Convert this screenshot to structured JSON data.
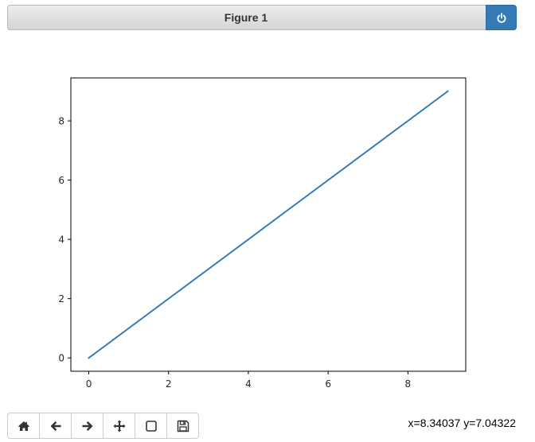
{
  "window": {
    "title": "Figure 1",
    "close_icon": "power-icon",
    "accent_color": "#337ab7"
  },
  "toolbar": {
    "buttons": [
      {
        "name": "home",
        "icon": "home-icon"
      },
      {
        "name": "back",
        "icon": "arrow-left-icon"
      },
      {
        "name": "forward",
        "icon": "arrow-right-icon"
      },
      {
        "name": "pan",
        "icon": "move-icon"
      },
      {
        "name": "zoom",
        "icon": "square-icon"
      },
      {
        "name": "save",
        "icon": "floppy-disk-icon"
      }
    ]
  },
  "status": {
    "coordinates": "x=8.34037 y=7.04322"
  },
  "chart_data": {
    "type": "line",
    "title": "",
    "xlabel": "",
    "ylabel": "",
    "x": [
      0,
      1,
      2,
      3,
      4,
      5,
      6,
      7,
      8,
      9
    ],
    "series": [
      {
        "values": [
          0,
          1,
          2,
          3,
          4,
          5,
          6,
          7,
          8,
          9
        ],
        "color": "#3a7db4"
      }
    ],
    "xlim": [
      -0.45,
      9.45
    ],
    "ylim": [
      -0.45,
      9.45
    ],
    "xticks": [
      0,
      2,
      4,
      6,
      8
    ],
    "yticks": [
      0,
      2,
      4,
      6,
      8
    ],
    "grid": false
  }
}
